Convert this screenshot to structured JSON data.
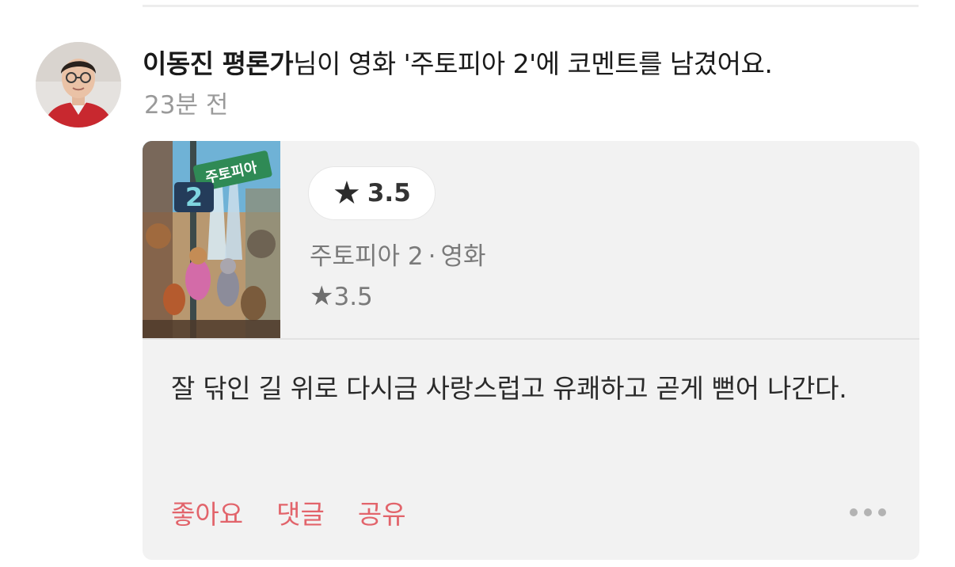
{
  "feed_item": {
    "author_name": "이동진 평론가",
    "action_text": "님이 영화 '주토피아 2'에 코멘트를 남겼어요.",
    "timestamp": "23분 전"
  },
  "movie_card": {
    "rating_badge": "3.5",
    "title": "주토피아 2",
    "separator": "·",
    "category": "영화",
    "user_rating": "3.5",
    "poster_title": "주토피아",
    "poster_number": "2"
  },
  "comment": {
    "text": "잘 닦인 길 위로 다시금 사랑스럽고 유쾌하고 곧게 뻗어 나간다."
  },
  "actions": {
    "like_label": "좋아요",
    "comment_label": "댓글",
    "share_label": "공유"
  },
  "icons": {
    "star": "star-icon",
    "more": "more-icon"
  },
  "colors": {
    "accent": "#e2646b",
    "card_bg": "#f2f2f2",
    "muted_text": "#9a9a9a"
  }
}
